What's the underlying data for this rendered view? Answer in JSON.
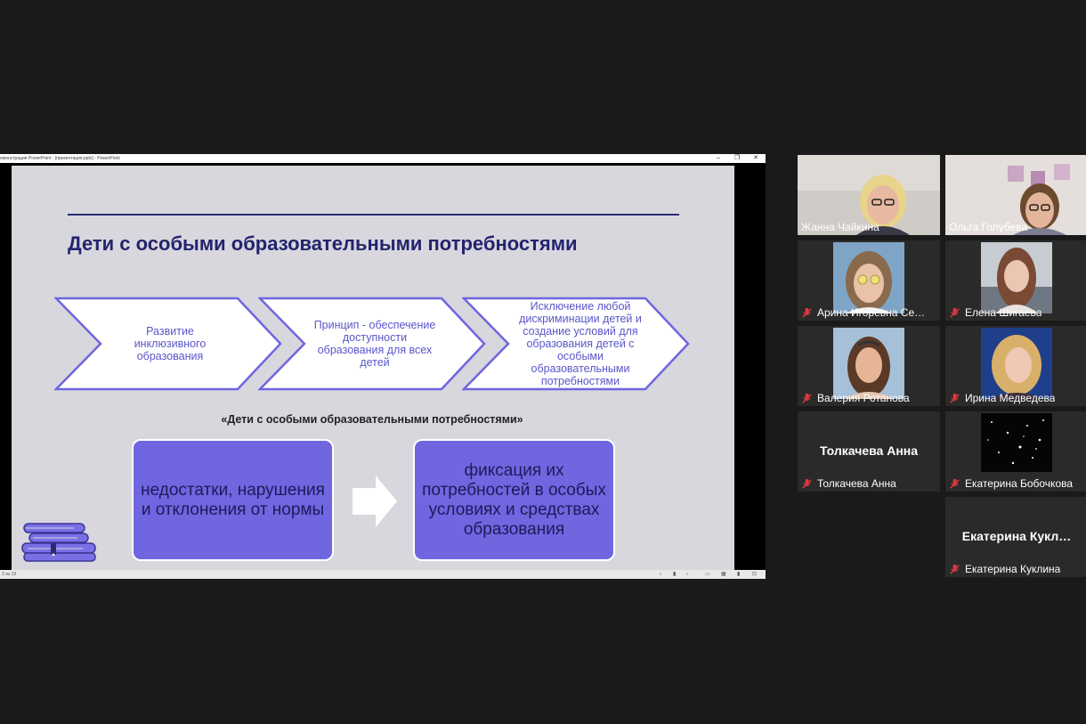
{
  "window": {
    "title": "емонстрация PowerPoint - [презентация.pptx] - PowerPoint",
    "controls": {
      "minimize": "–",
      "restore": "❐",
      "close": "✕"
    }
  },
  "slide": {
    "title": "Дети с особыми образовательными потребностями",
    "chevrons": [
      {
        "text": "Развитие инклюзивного образования"
      },
      {
        "text": "Принцип - обеспечение доступности образования для всех детей"
      },
      {
        "text": "Исключение любой дискриминации детей и создание условий для образования детей с особыми образовательными потребностями"
      }
    ],
    "quote": "«Дети с особыми образовательными потребностями»",
    "box_left": "недостатки, нарушения и отклонения от нормы",
    "box_right": "фиксация их потребностей в особых условиях и средствах образования",
    "accent_color": "#6f66e0",
    "title_color": "#24236e"
  },
  "statusbar": {
    "slide_counter": "2 из 19",
    "icons": [
      "prev-icon",
      "notes-icon",
      "next-icon",
      "normal-view-icon",
      "sorter-view-icon",
      "reading-view-icon",
      "slideshow-icon"
    ]
  },
  "participants": [
    {
      "name": "Жанна Чайкина",
      "muted": false,
      "video": "woman-glasses"
    },
    {
      "name": "Ольга  Голубева",
      "muted": false,
      "video": "woman-glasses-flowers"
    },
    {
      "name": "Арина Игоревна Се…",
      "muted": true,
      "video": "woman-sunglasses"
    },
    {
      "name": "Елена Шигаева",
      "muted": true,
      "video": "woman-outdoor"
    },
    {
      "name": "Валерия Ротанова",
      "muted": true,
      "video": "woman-brunette"
    },
    {
      "name": "Ирина Медведева",
      "muted": true,
      "video": "woman-blonde"
    },
    {
      "name": "Толкачева Анна",
      "muted": true,
      "video": "none",
      "big_name": "Толкачева Анна"
    },
    {
      "name": "Екатерина Бобочкова",
      "muted": true,
      "video": "starfield"
    },
    {
      "name": "Екатерина Куклина",
      "muted": true,
      "video": "none",
      "big_name": "Екатерина  Кукл…"
    }
  ]
}
